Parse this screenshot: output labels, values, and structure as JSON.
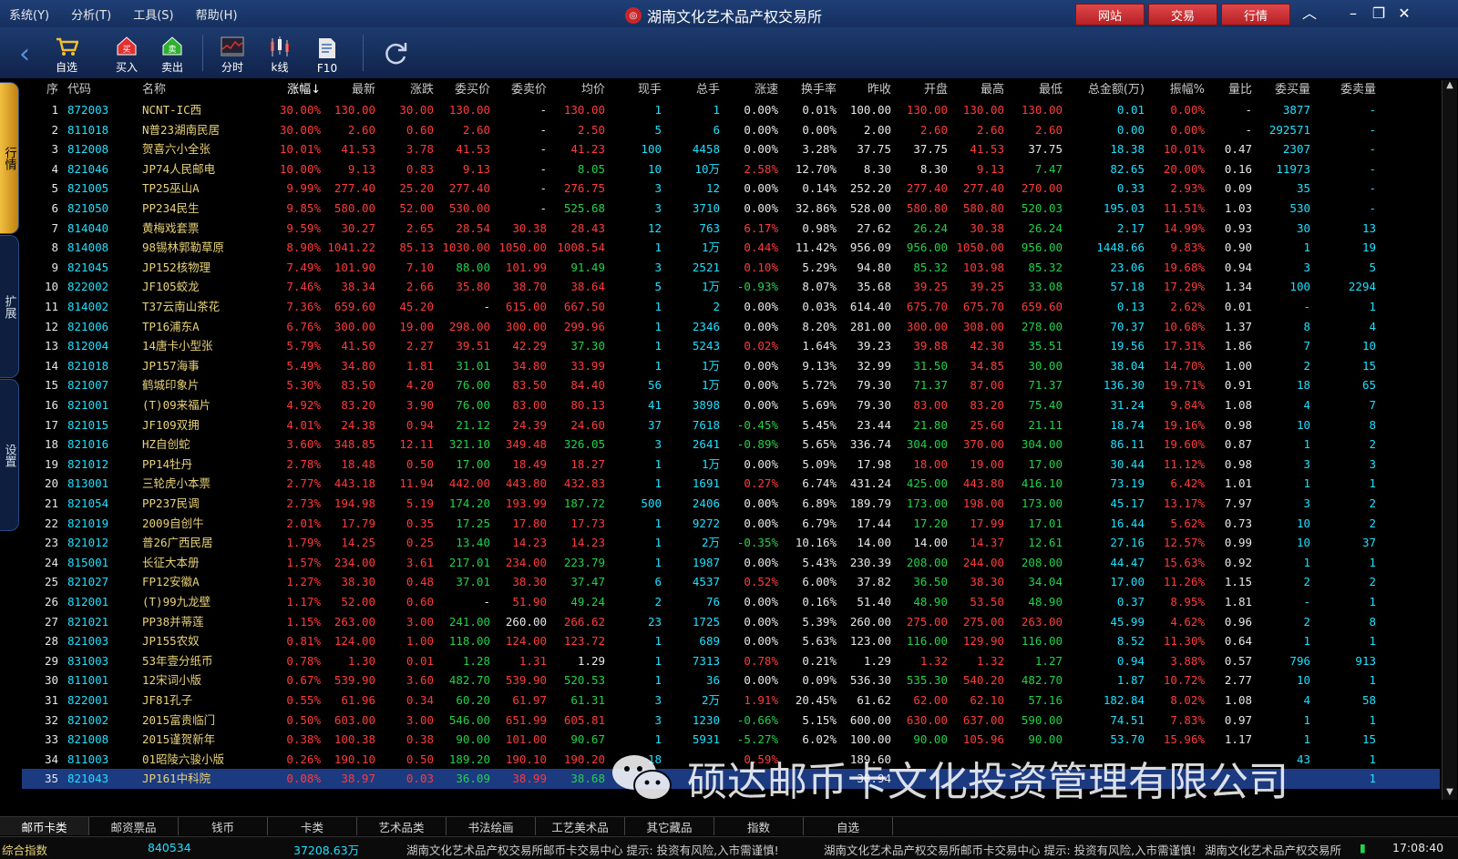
{
  "menu": [
    "系统(Y)",
    "分析(T)",
    "工具(S)",
    "帮助(H)"
  ],
  "title": "湖南文化艺术品产权交易所",
  "topbuttons": [
    "网站",
    "交易",
    "行情"
  ],
  "toolbar": {
    "back": "‹",
    "favorites": "自选",
    "buy": "买入",
    "sell": "卖出",
    "intraday": "分时",
    "kline": "k线",
    "f10": "F10"
  },
  "side_tabs": [
    "行情",
    "扩展",
    "设置"
  ],
  "columns": [
    "序",
    "代码",
    "名称",
    "涨幅↓",
    "最新",
    "涨跌",
    "委买价",
    "委卖价",
    "均价",
    "现手",
    "总手",
    "涨速",
    "换手率",
    "昨收",
    "开盘",
    "最高",
    "最低",
    "总金额(万)",
    "振幅%",
    "量比",
    "委买量",
    "委卖量"
  ],
  "rows": [
    [
      "1",
      "872003",
      "NCNT-IC西",
      "30.00%",
      "130.00",
      "30.00",
      "130.00",
      "-",
      "130.00",
      "1",
      "1",
      "0.00%",
      "0.01%",
      "100.00",
      "130.00",
      "130.00",
      "130.00",
      "0.01",
      "0.00%",
      "-",
      "3877",
      "-"
    ],
    [
      "2",
      "811018",
      "N普23湖南民居",
      "30.00%",
      "2.60",
      "0.60",
      "2.60",
      "-",
      "2.50",
      "5",
      "6",
      "0.00%",
      "0.00%",
      "2.00",
      "2.60",
      "2.60",
      "2.60",
      "0.00",
      "0.00%",
      "-",
      "292571",
      "-"
    ],
    [
      "3",
      "812008",
      "贺喜六小全张",
      "10.01%",
      "41.53",
      "3.78",
      "41.53",
      "-",
      "41.23",
      "100",
      "4458",
      "0.00%",
      "3.28%",
      "37.75",
      "37.75",
      "41.53",
      "37.75",
      "18.38",
      "10.01%",
      "0.47",
      "2307",
      "-"
    ],
    [
      "4",
      "821046",
      "JP74人民邮电",
      "10.00%",
      "9.13",
      "0.83",
      "9.13",
      "-",
      "8.05",
      "10",
      "10万",
      "2.58%",
      "12.70%",
      "8.30",
      "8.30",
      "9.13",
      "7.47",
      "82.65",
      "20.00%",
      "0.16",
      "11973",
      "-"
    ],
    [
      "5",
      "821005",
      "TP25巫山A",
      "9.99%",
      "277.40",
      "25.20",
      "277.40",
      "-",
      "276.75",
      "3",
      "12",
      "0.00%",
      "0.14%",
      "252.20",
      "277.40",
      "277.40",
      "270.00",
      "0.33",
      "2.93%",
      "0.09",
      "35",
      "-"
    ],
    [
      "6",
      "821050",
      "PP234民生",
      "9.85%",
      "580.00",
      "52.00",
      "530.00",
      "-",
      "525.68",
      "3",
      "3710",
      "0.00%",
      "32.86%",
      "528.00",
      "580.80",
      "580.80",
      "520.03",
      "195.03",
      "11.51%",
      "1.03",
      "530",
      "-"
    ],
    [
      "7",
      "814040",
      "黄梅戏套票",
      "9.59%",
      "30.27",
      "2.65",
      "28.54",
      "30.38",
      "28.43",
      "12",
      "763",
      "6.17%",
      "0.98%",
      "27.62",
      "26.24",
      "30.38",
      "26.24",
      "2.17",
      "14.99%",
      "0.93",
      "30",
      "13"
    ],
    [
      "8",
      "814008",
      "98锡林郭勒草原",
      "8.90%",
      "1041.22",
      "85.13",
      "1030.00",
      "1050.00",
      "1008.54",
      "1",
      "1万",
      "0.44%",
      "11.42%",
      "956.09",
      "956.00",
      "1050.00",
      "956.00",
      "1448.66",
      "9.83%",
      "0.90",
      "1",
      "19"
    ],
    [
      "9",
      "821045",
      "JP152核物理",
      "7.49%",
      "101.90",
      "7.10",
      "88.00",
      "101.99",
      "91.49",
      "3",
      "2521",
      "0.10%",
      "5.29%",
      "94.80",
      "85.32",
      "103.98",
      "85.32",
      "23.06",
      "19.68%",
      "0.94",
      "3",
      "5"
    ],
    [
      "10",
      "822002",
      "JF105蛟龙",
      "7.46%",
      "38.34",
      "2.66",
      "35.80",
      "38.70",
      "38.64",
      "5",
      "1万",
      "-0.93%",
      "8.07%",
      "35.68",
      "39.25",
      "39.25",
      "33.08",
      "57.18",
      "17.29%",
      "1.34",
      "100",
      "2294"
    ],
    [
      "11",
      "814002",
      "T37云南山茶花",
      "7.36%",
      "659.60",
      "45.20",
      "-",
      "615.00",
      "667.50",
      "1",
      "2",
      "0.00%",
      "0.03%",
      "614.40",
      "675.70",
      "675.70",
      "659.60",
      "0.13",
      "2.62%",
      "0.01",
      "-",
      "1"
    ],
    [
      "12",
      "821006",
      "TP16浦东A",
      "6.76%",
      "300.00",
      "19.00",
      "298.00",
      "300.00",
      "299.96",
      "1",
      "2346",
      "0.00%",
      "8.20%",
      "281.00",
      "300.00",
      "308.00",
      "278.00",
      "70.37",
      "10.68%",
      "1.37",
      "8",
      "4"
    ],
    [
      "13",
      "812004",
      "14唐卡小型张",
      "5.79%",
      "41.50",
      "2.27",
      "39.51",
      "42.29",
      "37.30",
      "1",
      "5243",
      "0.02%",
      "1.64%",
      "39.23",
      "39.88",
      "42.30",
      "35.51",
      "19.56",
      "17.31%",
      "1.86",
      "7",
      "10"
    ],
    [
      "14",
      "821018",
      "JP157海事",
      "5.49%",
      "34.80",
      "1.81",
      "31.01",
      "34.80",
      "33.99",
      "1",
      "1万",
      "0.00%",
      "9.13%",
      "32.99",
      "31.50",
      "34.85",
      "30.00",
      "38.04",
      "14.70%",
      "1.00",
      "2",
      "15"
    ],
    [
      "15",
      "821007",
      "鹤城印象片",
      "5.30%",
      "83.50",
      "4.20",
      "76.00",
      "83.50",
      "84.40",
      "56",
      "1万",
      "0.00%",
      "5.72%",
      "79.30",
      "71.37",
      "87.00",
      "71.37",
      "136.30",
      "19.71%",
      "0.91",
      "18",
      "65"
    ],
    [
      "16",
      "821001",
      "(T)09来福片",
      "4.92%",
      "83.20",
      "3.90",
      "76.00",
      "83.00",
      "80.13",
      "41",
      "3898",
      "0.00%",
      "5.69%",
      "79.30",
      "83.00",
      "83.20",
      "75.40",
      "31.24",
      "9.84%",
      "1.08",
      "4",
      "7"
    ],
    [
      "17",
      "821015",
      "JF109双拥",
      "4.01%",
      "24.38",
      "0.94",
      "21.12",
      "24.39",
      "24.60",
      "37",
      "7618",
      "-0.45%",
      "5.45%",
      "23.44",
      "21.80",
      "25.60",
      "21.11",
      "18.74",
      "19.16%",
      "0.98",
      "10",
      "8"
    ],
    [
      "18",
      "821016",
      "HZ自创蛇",
      "3.60%",
      "348.85",
      "12.11",
      "321.10",
      "349.48",
      "326.05",
      "3",
      "2641",
      "-0.89%",
      "5.65%",
      "336.74",
      "304.00",
      "370.00",
      "304.00",
      "86.11",
      "19.60%",
      "0.87",
      "1",
      "2"
    ],
    [
      "19",
      "821012",
      "PP14牡丹",
      "2.78%",
      "18.48",
      "0.50",
      "17.00",
      "18.49",
      "18.27",
      "1",
      "1万",
      "0.00%",
      "5.09%",
      "17.98",
      "18.00",
      "19.00",
      "17.00",
      "30.44",
      "11.12%",
      "0.98",
      "3",
      "3"
    ],
    [
      "20",
      "813001",
      "三轮虎小本票",
      "2.77%",
      "443.18",
      "11.94",
      "442.00",
      "443.80",
      "432.83",
      "1",
      "1691",
      "0.27%",
      "6.74%",
      "431.24",
      "425.00",
      "443.80",
      "416.10",
      "73.19",
      "6.42%",
      "1.01",
      "1",
      "1"
    ],
    [
      "21",
      "821054",
      "PP237民调",
      "2.73%",
      "194.98",
      "5.19",
      "174.20",
      "193.99",
      "187.72",
      "500",
      "2406",
      "0.00%",
      "6.89%",
      "189.79",
      "173.00",
      "198.00",
      "173.00",
      "45.17",
      "13.17%",
      "7.97",
      "3",
      "2"
    ],
    [
      "22",
      "821019",
      "2009自创牛",
      "2.01%",
      "17.79",
      "0.35",
      "17.25",
      "17.80",
      "17.73",
      "1",
      "9272",
      "0.00%",
      "6.79%",
      "17.44",
      "17.20",
      "17.99",
      "17.01",
      "16.44",
      "5.62%",
      "0.73",
      "10",
      "2"
    ],
    [
      "23",
      "821012",
      "普26广西民居",
      "1.79%",
      "14.25",
      "0.25",
      "13.40",
      "14.23",
      "14.23",
      "1",
      "2万",
      "-0.35%",
      "10.16%",
      "14.00",
      "14.00",
      "14.37",
      "12.61",
      "27.16",
      "12.57%",
      "0.99",
      "10",
      "37"
    ],
    [
      "24",
      "815001",
      "长征大本册",
      "1.57%",
      "234.00",
      "3.61",
      "217.01",
      "234.00",
      "223.79",
      "1",
      "1987",
      "0.00%",
      "5.43%",
      "230.39",
      "208.00",
      "244.00",
      "208.00",
      "44.47",
      "15.63%",
      "0.92",
      "1",
      "1"
    ],
    [
      "25",
      "821027",
      "FP12安徽A",
      "1.27%",
      "38.30",
      "0.48",
      "37.01",
      "38.30",
      "37.47",
      "6",
      "4537",
      "0.52%",
      "6.00%",
      "37.82",
      "36.50",
      "38.30",
      "34.04",
      "17.00",
      "11.26%",
      "1.15",
      "2",
      "2"
    ],
    [
      "26",
      "812001",
      "(T)99九龙壁",
      "1.17%",
      "52.00",
      "0.60",
      "-",
      "51.90",
      "49.24",
      "2",
      "76",
      "0.00%",
      "0.16%",
      "51.40",
      "48.90",
      "53.50",
      "48.90",
      "0.37",
      "8.95%",
      "1.81",
      "-",
      "1"
    ],
    [
      "27",
      "821021",
      "PP38并蒂莲",
      "1.15%",
      "263.00",
      "3.00",
      "241.00",
      "260.00",
      "266.62",
      "23",
      "1725",
      "0.00%",
      "5.39%",
      "260.00",
      "275.00",
      "275.00",
      "263.00",
      "45.99",
      "4.62%",
      "0.96",
      "2",
      "8"
    ],
    [
      "28",
      "821003",
      "JP155农奴",
      "0.81%",
      "124.00",
      "1.00",
      "118.00",
      "124.00",
      "123.72",
      "1",
      "689",
      "0.00%",
      "5.63%",
      "123.00",
      "116.00",
      "129.90",
      "116.00",
      "8.52",
      "11.30%",
      "0.64",
      "1",
      "1"
    ],
    [
      "29",
      "831003",
      "53年壹分纸币",
      "0.78%",
      "1.30",
      "0.01",
      "1.28",
      "1.31",
      "1.29",
      "1",
      "7313",
      "0.78%",
      "0.21%",
      "1.29",
      "1.32",
      "1.32",
      "1.27",
      "0.94",
      "3.88%",
      "0.57",
      "796",
      "913"
    ],
    [
      "30",
      "811001",
      "12宋词小版",
      "0.67%",
      "539.90",
      "3.60",
      "482.70",
      "539.90",
      "520.53",
      "1",
      "36",
      "0.00%",
      "0.09%",
      "536.30",
      "535.30",
      "540.20",
      "482.70",
      "1.87",
      "10.72%",
      "2.77",
      "10",
      "1"
    ],
    [
      "31",
      "822001",
      "JF81孔子",
      "0.55%",
      "61.96",
      "0.34",
      "60.20",
      "61.97",
      "61.31",
      "3",
      "2万",
      "1.91%",
      "20.45%",
      "61.62",
      "62.00",
      "62.10",
      "57.16",
      "182.84",
      "8.02%",
      "1.08",
      "4",
      "58"
    ],
    [
      "32",
      "821002",
      "2015富贵临门",
      "0.50%",
      "603.00",
      "3.00",
      "546.00",
      "651.99",
      "605.81",
      "3",
      "1230",
      "-0.66%",
      "5.15%",
      "600.00",
      "630.00",
      "637.00",
      "590.00",
      "74.51",
      "7.83%",
      "0.97",
      "1",
      "1"
    ],
    [
      "33",
      "821008",
      "2015谨贺新年",
      "0.38%",
      "100.38",
      "0.38",
      "90.00",
      "101.00",
      "90.67",
      "1",
      "5931",
      "-5.27%",
      "6.02%",
      "100.00",
      "90.00",
      "105.96",
      "90.00",
      "53.70",
      "15.96%",
      "1.17",
      "1",
      "15"
    ],
    [
      "34",
      "811003",
      "01昭陵六骏小版",
      "0.26%",
      "190.10",
      "0.50",
      "189.20",
      "190.10",
      "190.20",
      "18",
      "",
      "0.59%",
      "",
      "189.60",
      "",
      "",
      "",
      "",
      "",
      "",
      "43",
      "1"
    ],
    [
      "35",
      "821043",
      "JP161中科院",
      "0.08%",
      "38.97",
      "0.03",
      "36.09",
      "38.99",
      "38.68",
      "",
      "",
      "",
      "",
      "38.94",
      "",
      "",
      "",
      "",
      "",
      "",
      "",
      "1"
    ]
  ],
  "bottom_tabs": [
    "邮币卡类",
    "邮资票品",
    "钱币",
    "卡类",
    "艺术品类",
    "书法绘画",
    "工艺美术品",
    "其它藏品",
    "指数",
    "自选"
  ],
  "status": {
    "index_label": "综合指数",
    "index_value": "840534",
    "amount": "37208.63万",
    "ticker": "湖南文化艺术品产权交易所邮币卡交易中心  提示: 投资有风险,入市需谨慎!",
    "ticker2": "湖南文化艺术品产权交易所邮币卡交易中心  提示: 投资有风险,入市需谨慎!",
    "ticker3": "湖南文化艺术品产权交易所",
    "time": "17:08:40"
  },
  "watermark": "硕达邮币卡文化投资管理有限公司",
  "colors": {
    "up": "#ff3b3b",
    "down": "#22d24a",
    "flat": "#e8e8e8",
    "code": "#1ee0ff",
    "name": "#e8d27a",
    "accent": "#c8262a"
  }
}
